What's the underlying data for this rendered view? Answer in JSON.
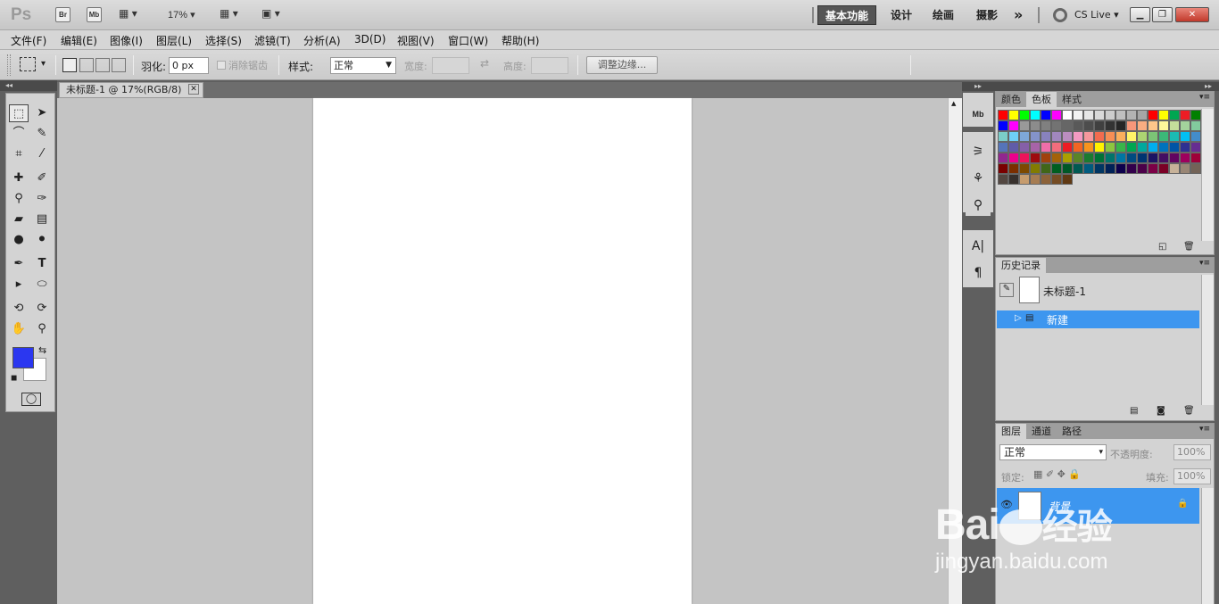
{
  "appbar": {
    "logo": "Ps",
    "bridge_label": "Br",
    "mini_bridge_label": "Mb",
    "zoom": "17%",
    "workspaces": [
      "基本功能",
      "设计",
      "绘画",
      "摄影"
    ],
    "more": "»",
    "cs_live": "CS Live"
  },
  "menu": [
    "文件(F)",
    "编辑(E)",
    "图像(I)",
    "图层(L)",
    "选择(S)",
    "滤镜(T)",
    "分析(A)",
    "3D(D)",
    "视图(V)",
    "窗口(W)",
    "帮助(H)"
  ],
  "options": {
    "feather_label": "羽化:",
    "feather_value": "0 px",
    "antialias_label": "消除锯齿",
    "style_label": "样式:",
    "style_value": "正常",
    "width_label": "宽度:",
    "height_label": "高度:",
    "refine_edge": "调整边缘..."
  },
  "document": {
    "tab_title": "未标题-1 @ 17%(RGB/8)"
  },
  "swatches_panel": {
    "tabs": [
      "颜色",
      "色板",
      "样式"
    ],
    "colors": [
      "#ff0000",
      "#ffff00",
      "#00ff00",
      "#00ffff",
      "#0000ff",
      "#ff00ff",
      "#ffffff",
      "#f2f2f2",
      "#e6e6e6",
      "#d9d9d9",
      "#cccccc",
      "#bfbfbf",
      "#b3b3b3",
      "#a6a6a6",
      "#ff0000",
      "#ffff00",
      "#00a651",
      "#ed1c24",
      "#008000",
      "#0000ff",
      "#ff00ff",
      "#999999",
      "#8c8c8c",
      "#808080",
      "#737373",
      "#666666",
      "#595959",
      "#4d4d4d",
      "#404040",
      "#333333",
      "#262626",
      "#f7977a",
      "#f9ad81",
      "#fdc68a",
      "#fff79a",
      "#c4df9b",
      "#a3d39c",
      "#82ca9d",
      "#7bcdc8",
      "#6ecff6",
      "#7ea7d8",
      "#8493ca",
      "#8882be",
      "#a187be",
      "#bc8dbf",
      "#f49ac2",
      "#f6989d",
      "#f26c4f",
      "#f68e55",
      "#fbaf5d",
      "#fff468",
      "#acd372",
      "#7cc576",
      "#3bb878",
      "#1abbb4",
      "#00bff3",
      "#438cca",
      "#5574b9",
      "#605ca8",
      "#855fa8",
      "#a763a8",
      "#f06ea9",
      "#f26d7d",
      "#ed1c24",
      "#f26522",
      "#f7941d",
      "#fff200",
      "#8dc63f",
      "#39b54a",
      "#00a651",
      "#00a99d",
      "#00aeef",
      "#0072bc",
      "#0054a6",
      "#2e3192",
      "#662d91",
      "#92278f",
      "#ec008c",
      "#ed145b",
      "#9e0b0f",
      "#a0410d",
      "#a36209",
      "#aba000",
      "#598527",
      "#1a7b30",
      "#007236",
      "#00746b",
      "#0076a3",
      "#004b80",
      "#003471",
      "#1b1464",
      "#440e62",
      "#630460",
      "#9e005d",
      "#9e0039",
      "#790000",
      "#7b2e00",
      "#7d4900",
      "#827b00",
      "#406618",
      "#005e20",
      "#005826",
      "#005952",
      "#005b7f",
      "#003663",
      "#002157",
      "#0d004c",
      "#32004b",
      "#4b0049",
      "#7b0046",
      "#7a0026",
      "#c7b299",
      "#998675",
      "#736357",
      "#534741",
      "#37302d",
      "#c69c6e",
      "#a67c52",
      "#8c6239",
      "#754c24",
      "#603913"
    ]
  },
  "history_panel": {
    "tabs": [
      "历史记录"
    ],
    "snapshot": "未标题-1",
    "step": "新建"
  },
  "layers_panel": {
    "tabs": [
      "图层",
      "通道",
      "路径"
    ],
    "blend_mode": "正常",
    "opacity_label": "不透明度:",
    "opacity": "100%",
    "lock_label": "锁定:",
    "fill_label": "填充:",
    "fill": "100%",
    "layer_name": "背景"
  },
  "watermark": {
    "brand": "Bai",
    "brand2": "经验",
    "url": "jingyan.baidu.com"
  },
  "colors": {
    "foreground": "#2b37f0",
    "background": "#ffffff",
    "selection": "#3d96ef"
  }
}
